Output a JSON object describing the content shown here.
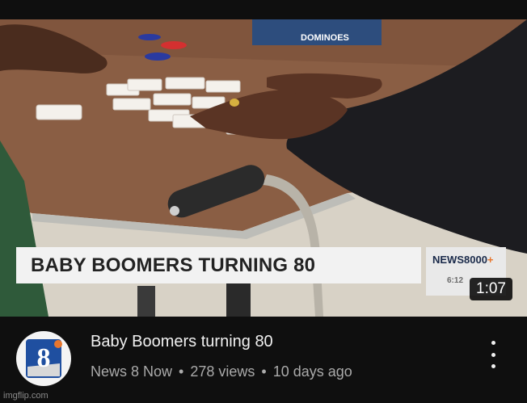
{
  "video": {
    "title": "Baby Boomers turning 80",
    "channel": "News 8 Now",
    "views": "278 views",
    "age": "10 days ago",
    "duration": "1:07"
  },
  "thumbnail": {
    "lower_third": "BABY BOOMERS TURNING 80",
    "box_text": "DOMINOES",
    "station_brand": "NEWS",
    "station_number": "8000",
    "station_plus": "+",
    "clock": "6:12"
  },
  "channel_logo": {
    "icon": "news8-logo-icon",
    "mark": "8"
  },
  "more_menu": {
    "icon": "more-vertical-icon"
  },
  "watermark": "imgflip.com",
  "colors": {
    "background": "#0f0f0f",
    "title": "#f1f1f1",
    "meta": "#aaaaaa",
    "logo_blue": "#1f4fa0"
  }
}
